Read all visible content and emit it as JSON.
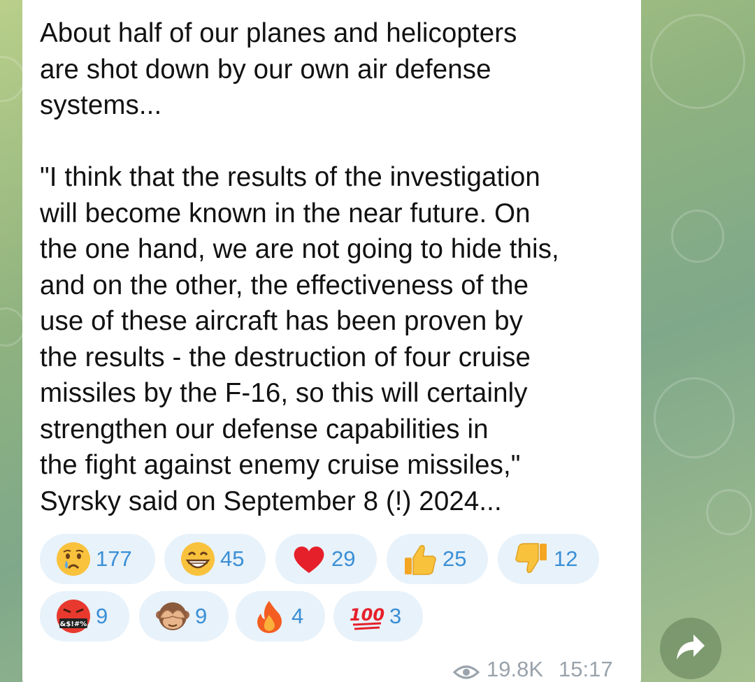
{
  "message": {
    "text": "About half of our planes and helicopters\nare shot down by our own air defense\nsystems...\n\n\"I think that the results of the investigation\nwill become known in the near future. On\nthe one hand, we are not going to hide this,\nand on the other, the effectiveness of the\nuse of these aircraft has been proven by\nthe results - the destruction of four cruise\nmissiles by the F-16, so this will certainly\nstrengthen our defense capabilities in\nthe fight against enemy cruise missiles,\"\nSyrsky said on September 8 (!) 2024...",
    "views": "19.8K",
    "time": "15:17"
  },
  "reactions": [
    {
      "emoji": "crying-face",
      "count": "177"
    },
    {
      "emoji": "grinning-face",
      "count": "45"
    },
    {
      "emoji": "red-heart",
      "count": "29"
    },
    {
      "emoji": "thumbs-up",
      "count": "25"
    },
    {
      "emoji": "thumbs-down",
      "count": "12"
    },
    {
      "emoji": "cursing-face",
      "count": "9"
    },
    {
      "emoji": "see-no-evil-monkey",
      "count": "9"
    },
    {
      "emoji": "fire",
      "count": "4"
    },
    {
      "emoji": "hundred-points",
      "count": "3"
    }
  ],
  "colors": {
    "reaction_bg": "#e8f2fa",
    "reaction_count": "#3a8fd6",
    "meta_text": "#9aa3ab"
  }
}
